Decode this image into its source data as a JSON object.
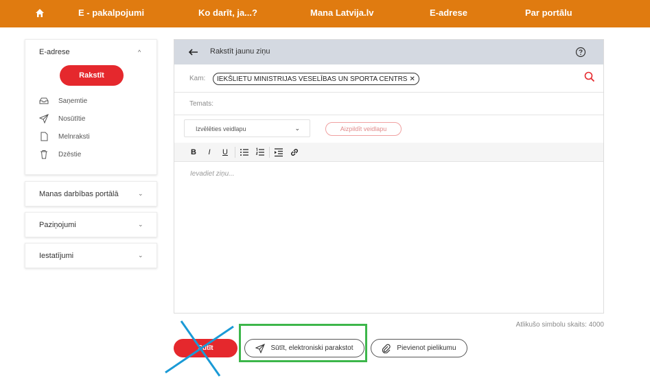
{
  "nav": {
    "home_icon": "home-icon",
    "items": [
      "E - pakalpojumi",
      "Ko darīt, ja...?",
      "Mana Latvija.lv",
      "E-adrese",
      "Par portālu"
    ],
    "color": "#e07b10"
  },
  "sidebar": {
    "eadrese": {
      "title": "E-adrese",
      "write_button": "Rakstīt",
      "items": [
        "Saņemtie",
        "Nosūtītie",
        "Melnraksti",
        "Dzēstie"
      ]
    },
    "sections": [
      "Manas darbības portālā",
      "Paziņojumi",
      "Iestatījumi"
    ]
  },
  "compose": {
    "title": "Rakstīt jaunu ziņu",
    "to_label": "Kam:",
    "recipient": "IEKŠLIETU MINISTRIJAS VESELĪBAS UN SPORTA CENTRS",
    "subject_label": "Temats:",
    "template_select": "Izvēlēties veidlapu",
    "fill_template_button": "Aizpildīt veidlapu",
    "toolbar": [
      "B",
      "I",
      "U"
    ],
    "message_placeholder": "Ievadiet ziņu...",
    "counter_text": "Atlikušo simbolu skaits: 4000"
  },
  "actions": {
    "send": "Sūtīt",
    "send_signed": "Sūtīt, elektroniski parakstot",
    "attach": "Pievienot pielikumu"
  },
  "colors": {
    "accent_red": "#e5282d",
    "highlight_green": "#3cb64a",
    "cross_blue": "#1a9ad6"
  }
}
